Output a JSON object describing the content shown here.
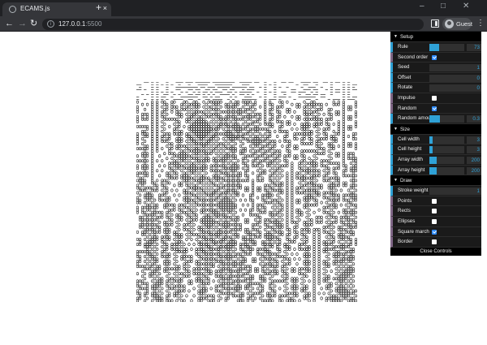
{
  "browser": {
    "tab_title": "ECAMS.js",
    "tab_close": "×",
    "new_tab": "+",
    "url_host": "127.0.0.1",
    "url_port": ":5500",
    "profile_label": "Guest",
    "window_minimize": "–",
    "window_maximize": "□",
    "window_close": "✕"
  },
  "gui": {
    "setup": {
      "title": "Setup",
      "rule": {
        "label": "Rule",
        "value": "73",
        "fraction": 0.29
      },
      "second_order": {
        "label": "Second order",
        "checked": true
      },
      "seed": {
        "label": "Seed",
        "value": "1"
      },
      "offset": {
        "label": "Offset",
        "value": "0"
      },
      "rotate": {
        "label": "Rotate",
        "value": "0"
      },
      "impulse": {
        "label": "Impulse",
        "checked": false
      },
      "random": {
        "label": "Random",
        "checked": true
      },
      "random_amount": {
        "label": "Random amount",
        "value": "0.3",
        "fraction": 0.3
      }
    },
    "size": {
      "title": "Size",
      "cell_width": {
        "label": "Cell width",
        "value": "3",
        "fraction": 0.1
      },
      "cell_height": {
        "label": "Cell height",
        "value": "3",
        "fraction": 0.1
      },
      "array_width": {
        "label": "Array width",
        "value": "200",
        "fraction": 0.2
      },
      "array_height": {
        "label": "Array height",
        "value": "200",
        "fraction": 0.2
      }
    },
    "draw": {
      "title": "Draw",
      "stroke_weight": {
        "label": "Stroke weight",
        "value": "1"
      },
      "points": {
        "label": "Points",
        "checked": false
      },
      "rects": {
        "label": "Rects",
        "checked": false
      },
      "ellipses": {
        "label": "Ellipses",
        "checked": false
      },
      "square_march": {
        "label": "Square march",
        "checked": true
      },
      "border": {
        "label": "Border",
        "checked": false
      }
    },
    "close_controls": "Close Controls"
  },
  "colors": {
    "chrome_dark": "#202124",
    "chrome_tab": "#35363a",
    "gui_bg": "#1a1a1a",
    "number_accent": "#2fa1d6",
    "bool_accent": "#806787",
    "checkbox_checked": "#2e8bff"
  }
}
